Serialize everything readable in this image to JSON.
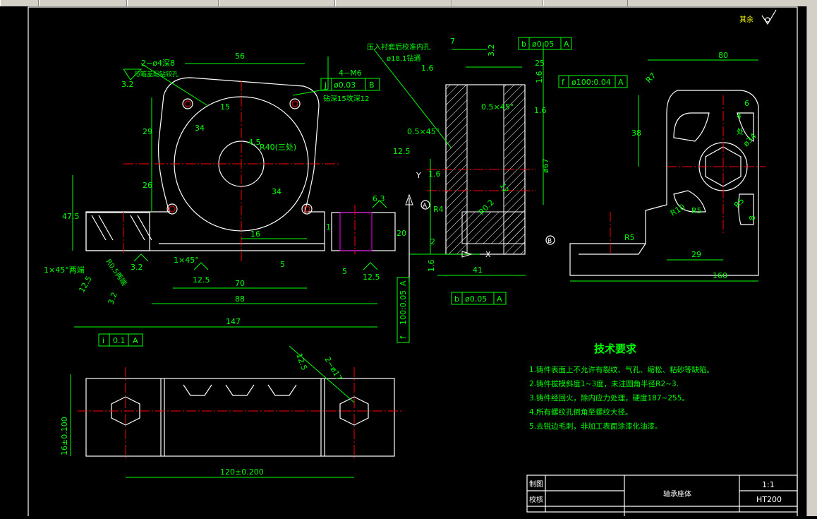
{
  "window_tabs": [
    "",
    "",
    "",
    "",
    "",
    "",
    ""
  ],
  "drawing": {
    "front_view": {
      "dims": {
        "top_width": "56",
        "holes_2": "2−ø4深8",
        "holes_2_note": "与箱盖配钻铰孔",
        "roughness_32a": "3.2",
        "m6": "4−M6",
        "m6_depth": "钻深15攻深12",
        "tol_j": "j",
        "tol_j_val": "ø0.03",
        "tol_j_ref": "B",
        "d29": "29",
        "d34a": "34",
        "d15": "15",
        "d26": "26",
        "d34b": "34",
        "d45": "4.5",
        "r40": "R40(三处)",
        "h475": "47.5",
        "d16": "16",
        "d1": "1",
        "d5a": "5",
        "d5b": "5",
        "d20": "20",
        "d63": "6.3",
        "d70": "70",
        "d88": "88",
        "d147": "147",
        "chamfer1": "1×45°",
        "chamfer2": "1×45°两端",
        "r05": "R0.5两端",
        "ra125a": "12.5",
        "ra125b": "12.5",
        "ra125c": "12.5",
        "ra32b": "3.2",
        "ra32c": "3.2",
        "tol_i": "i",
        "tol_i_val": "0.1",
        "tol_i_ref": "A"
      }
    },
    "section_view": {
      "note1": "压入衬套后校准内孔",
      "note2": "ø18.1钻通",
      "d7": "7",
      "d32": "3.2",
      "d25": "25",
      "tol_b1": "b",
      "tol_b1_val": "ø0.05",
      "tol_b1_ref": "A",
      "tol_f1": "f",
      "tol_f1_val": "ø100:0.04",
      "tol_f1_ref": "A",
      "d16a": "1.6",
      "d16b": "1.6",
      "d16c": "1.6",
      "d16d": "1.6",
      "d16e": "1.6",
      "chamfer_a": "0.5×45°",
      "chamfer_b": "0.5×45°",
      "ra125": "12.5",
      "phi67": "ø67",
      "d12": "12",
      "r4": "R4",
      "r02": "R0.2",
      "d2": "2",
      "d41": "41",
      "tol_b2": "b",
      "tol_b2_val": "ø0.05",
      "tol_b2_ref": "A",
      "tol_f2": "f",
      "tol_f2_val": "100:0.05",
      "tol_f2_ref": "A",
      "label_a": "A",
      "label_b": "B",
      "label_y": "Y",
      "label_x": "X"
    },
    "side_view": {
      "d80": "80",
      "r7": "R7",
      "d38": "38",
      "d6": "6",
      "d4": "4",
      "note": "处",
      "phi34": "ø34",
      "r10": "R10",
      "r5a": "R5",
      "r5b": "R5",
      "r5c": "R5",
      "d8": "8",
      "d29": "29",
      "d160": "160"
    },
    "top_view": {
      "holes": "2−ø17",
      "ra": "12.5",
      "h16": "16±0.100",
      "w120": "120±0.200"
    },
    "corner": {
      "label": "其余"
    },
    "tech_req": {
      "title": "技术要求",
      "items": [
        "1.铸件表面上不允许有裂纹、气孔、缩松、粘砂等缺陷。",
        "2.铸件拔模斜度1~3度，未注圆角半径R2~3.",
        "3.铸件经回火，除内应力处理，硬度187~255。",
        "4.所有螺纹孔倒角至螺纹大径。",
        "5.去锐边毛刺，非加工表面涂漆化油漆。"
      ]
    },
    "title_block": {
      "drawn": "制图",
      "checked": "校核",
      "name": "轴承座体",
      "scale": "1:1",
      "material": "HT200"
    }
  }
}
